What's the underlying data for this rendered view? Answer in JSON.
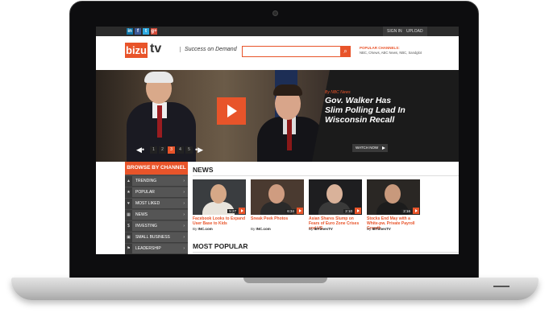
{
  "topbar": {
    "social": [
      "in",
      "f",
      "t",
      "g+"
    ],
    "sign_in": "SIGN IN",
    "upload": "UPLOAD"
  },
  "header": {
    "logo_bizu": "bizu",
    "logo_tv": "tv",
    "tagline": "Success on Demand",
    "search_placeholder": "",
    "popular_label": "POPULAR CHANNELS:",
    "popular_list": "NBC, CNews, ABC News, NBC, Sandglot"
  },
  "hero": {
    "kicker": "By NBC News",
    "title": "Gov. Walker Has Slim Polling Lead In Wisconsin Recall",
    "watch_now": "WATCH NOW",
    "pages": [
      "1",
      "2",
      "3",
      "4",
      "5"
    ],
    "active_page": 2
  },
  "sidebar": {
    "heading": "BROWSE BY CHANNEL",
    "items": [
      {
        "label": "TRENDING",
        "icon": "trending-icon"
      },
      {
        "label": "POPULAR",
        "icon": "popular-icon"
      },
      {
        "label": "MOST LIKED",
        "icon": "thumbs-up-icon"
      },
      {
        "label": "NEWS",
        "icon": "news-icon"
      },
      {
        "label": "INVESTING",
        "icon": "dollar-icon"
      },
      {
        "label": "SMALL BUSINESS",
        "icon": "briefcase-icon"
      },
      {
        "label": "LEADERSHIP",
        "icon": "leadership-icon"
      }
    ]
  },
  "news": {
    "heading": "NEWS",
    "cards": [
      {
        "title": "Facebook Looks to Expand User Base to Kids",
        "duration": "5:27",
        "by": "By",
        "source": "INC.com"
      },
      {
        "title": "Sneak Peek Photos",
        "duration": "6:34",
        "by": "By",
        "source": "INC.com"
      },
      {
        "title": "Asian Shares Slump on Fears of Euro Zone Crises and US",
        "duration": "2:10",
        "by": "By",
        "source": "IBTimesTV"
      },
      {
        "title": "Stocks End May with a White-pw. Private Payroll Growth",
        "duration": "2:16",
        "by": "By",
        "source": "IBTimesTV"
      }
    ]
  },
  "most_popular": {
    "heading": "MOST POPULAR"
  },
  "colors": {
    "accent": "#e8542a",
    "dark": "#1b1b1b",
    "sidebar": "#555555"
  }
}
